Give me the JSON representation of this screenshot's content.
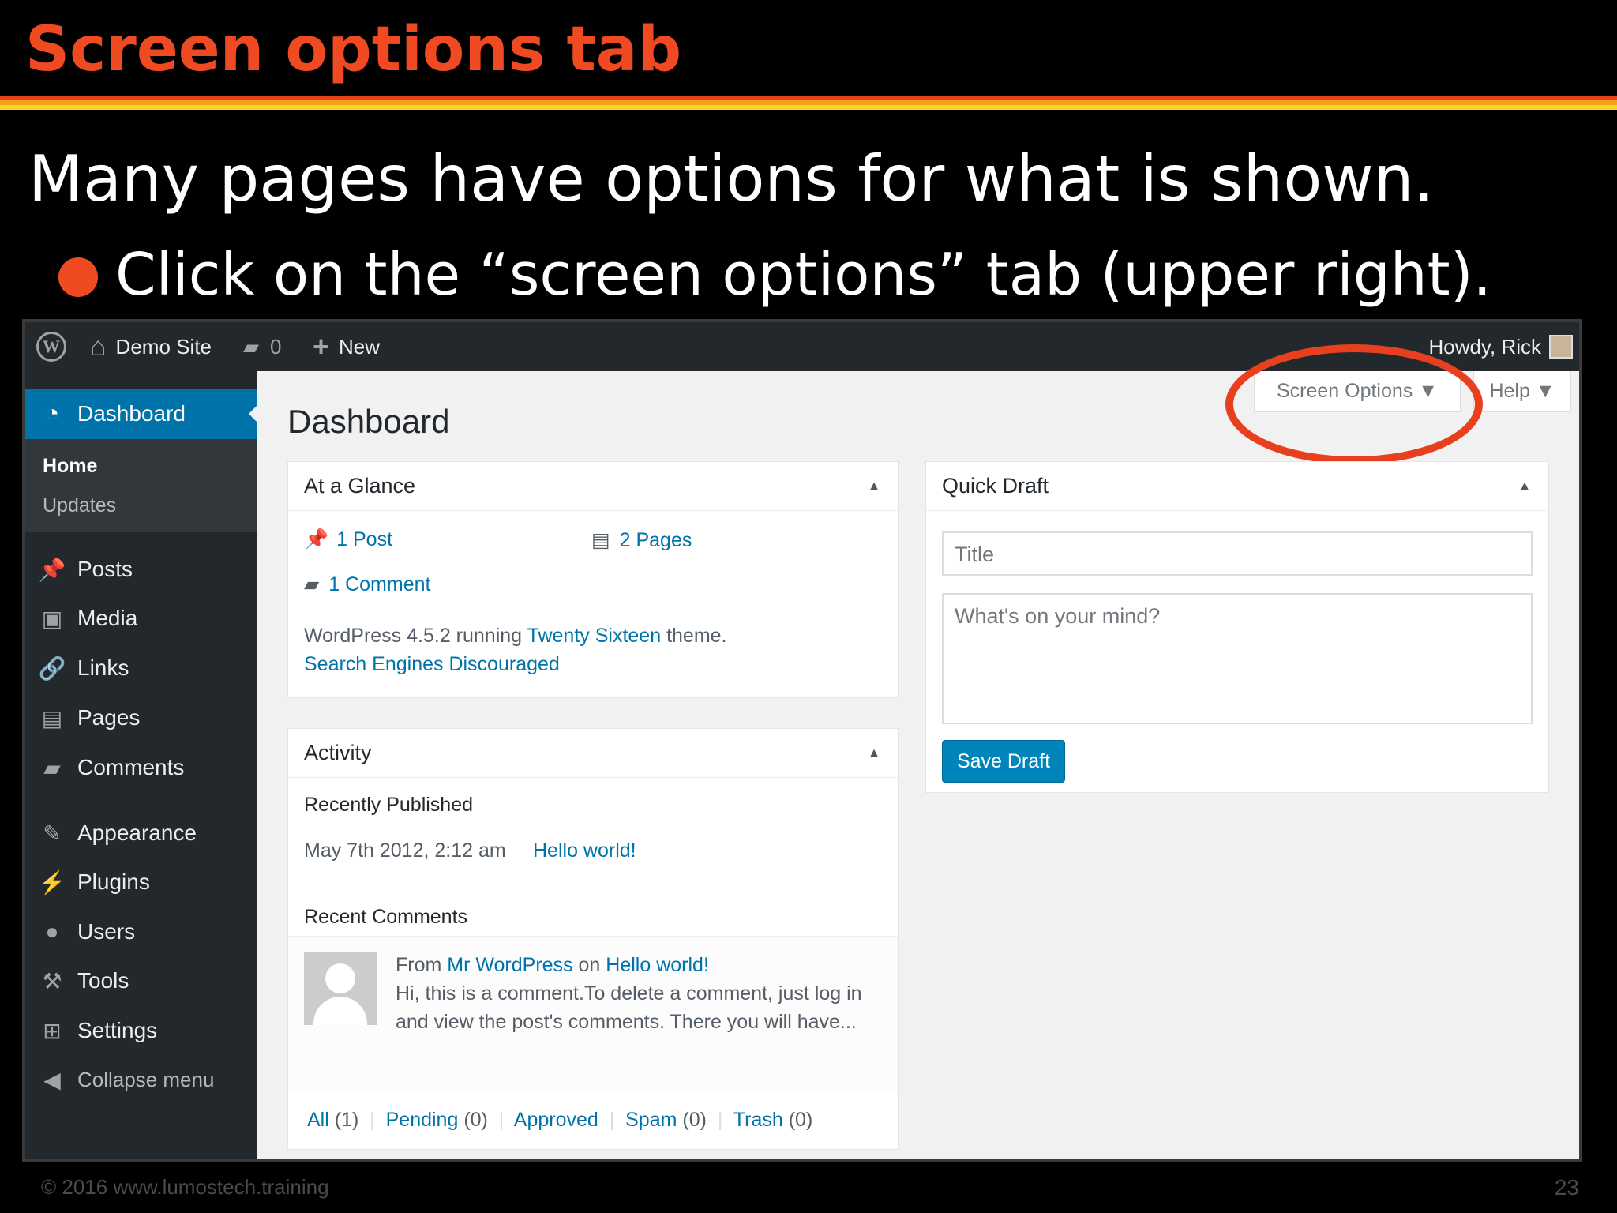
{
  "slide": {
    "title": "Screen options tab",
    "subtitle": "Many pages have options for what is shown.",
    "bullet": "Click on the “screen options” tab (upper right).",
    "footer": "© 2016  www.lumostech.training",
    "page_number": "23",
    "colors": {
      "title": "#f04a23",
      "rule": [
        "#e8401f",
        "#f5a019",
        "#f9d521"
      ],
      "highlight_circle": "#e8401f"
    }
  },
  "admin_bar": {
    "wp_logo": "W",
    "home_icon": "⌂",
    "site_name": "Demo Site",
    "comments_icon": "▰",
    "comments_count": "0",
    "new_icon": "+",
    "new_label": "New",
    "greeting": "Howdy, Rick"
  },
  "sidebar": {
    "active": {
      "icon": "dashboard-icon",
      "label": "Dashboard"
    },
    "submenu": [
      {
        "label": "Home"
      },
      {
        "label": "Updates"
      }
    ],
    "items": [
      {
        "icon": "pushpin-icon",
        "glyph": "📌",
        "label": "Posts"
      },
      {
        "icon": "media-icon",
        "glyph": "▣",
        "label": "Media"
      },
      {
        "icon": "links-icon",
        "glyph": "🔗",
        "label": "Links"
      },
      {
        "icon": "pages-icon",
        "glyph": "▤",
        "label": "Pages"
      },
      {
        "icon": "comments-icon",
        "glyph": "▰",
        "label": "Comments"
      },
      {
        "icon": "appearance-icon",
        "glyph": "✎",
        "label": "Appearance"
      },
      {
        "icon": "plugins-icon",
        "glyph": "⚡",
        "label": "Plugins"
      },
      {
        "icon": "users-icon",
        "glyph": "●",
        "label": "Users"
      },
      {
        "icon": "tools-icon",
        "glyph": "⚒",
        "label": "Tools"
      },
      {
        "icon": "settings-icon",
        "glyph": "⊞",
        "label": "Settings"
      }
    ],
    "collapse": {
      "icon": "collapse-icon",
      "glyph": "◀",
      "label": "Collapse menu"
    }
  },
  "main": {
    "page_title": "Dashboard",
    "screen_options": "Screen Options ▼",
    "help": "Help ▼",
    "at_a_glance": {
      "title": "At a Glance",
      "posts": "1 Post",
      "pages": "2 Pages",
      "comments": "1 Comment",
      "wp_text_pre": "WordPress 4.5.2 running",
      "theme": "Twenty Sixteen",
      "wp_text_post": "theme.",
      "search_engines": "Search Engines Discouraged"
    },
    "activity": {
      "title": "Activity",
      "recently_published": "Recently Published",
      "pub_date": "May 7th 2012, 2:12 am",
      "pub_link": "Hello world!",
      "recent_comments": "Recent Comments",
      "comment_from": "From",
      "comment_author": "Mr WordPress",
      "comment_on": "on",
      "comment_post": "Hello world!",
      "comment_line1": "Hi, this is a comment.To delete a comment, just log in",
      "comment_line2": "and view the post's comments. There you will have...",
      "filters": [
        {
          "label": "All",
          "count": "(1)"
        },
        {
          "label": "Pending",
          "count": "(0)"
        },
        {
          "label": "Approved",
          "count": ""
        },
        {
          "label": "Spam",
          "count": "(0)"
        },
        {
          "label": "Trash",
          "count": "(0)"
        }
      ]
    },
    "quick_draft": {
      "title": "Quick Draft",
      "title_placeholder": "Title",
      "content_placeholder": "What's on your mind?",
      "save_button": "Save Draft"
    }
  }
}
